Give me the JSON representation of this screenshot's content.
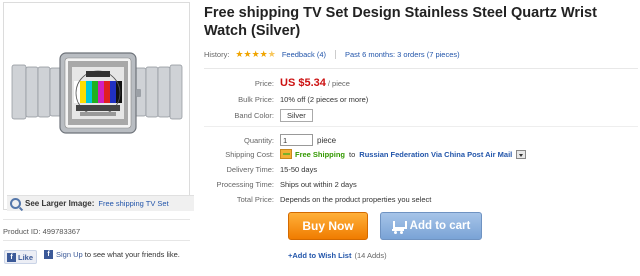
{
  "image_panel": {
    "see_larger_label": "See Larger Image:",
    "see_larger_link": "Free shipping TV Set",
    "product_id": "Product ID: 499783367"
  },
  "social": {
    "like_label": "Like",
    "fb_icon_glyph": "f",
    "signup_link": "Sign Up",
    "signup_text": " to see what your friends like."
  },
  "product": {
    "title": "Free shipping TV Set Design Stainless Steel Quartz Wrist Watch (Silver)",
    "history_label": "History:",
    "rating_stars": 4.5,
    "feedback_link": "Feedback (4)",
    "orders_link": "Past 6 months: 3 orders (7 pieces)"
  },
  "details": {
    "price_label": "Price:",
    "price_value": "US $5.34",
    "price_unit": "/ piece",
    "bulk_label": "Bulk Price:",
    "bulk_value": "10% off (2 pieces or more)",
    "color_label": "Band Color:",
    "color_value": "Silver",
    "qty_label": "Quantity:",
    "qty_value": "1",
    "qty_unit": "piece",
    "shipping_label": "Shipping Cost:",
    "shipping_value": "Free Shipping",
    "shipping_to": "to",
    "shipping_dest": "Russian Federation Via China Post Air Mail",
    "delivery_label": "Delivery Time:",
    "delivery_value": "15-50 days",
    "processing_label": "Processing Time:",
    "processing_value": "Ships out within 2 days",
    "total_label": "Total Price:",
    "total_value": "Depends on the product properties you select"
  },
  "actions": {
    "buy_now": "Buy Now",
    "add_to_cart": "Add to cart",
    "wishlist_link": "+Add to Wish List",
    "wishlist_count": "(14 Adds)"
  },
  "colors": {
    "price_red": "#cc1111",
    "link_blue": "#2255aa",
    "free_green": "#339900",
    "buy_orange": "#f07c00",
    "cart_blue": "#7aa3d6"
  }
}
